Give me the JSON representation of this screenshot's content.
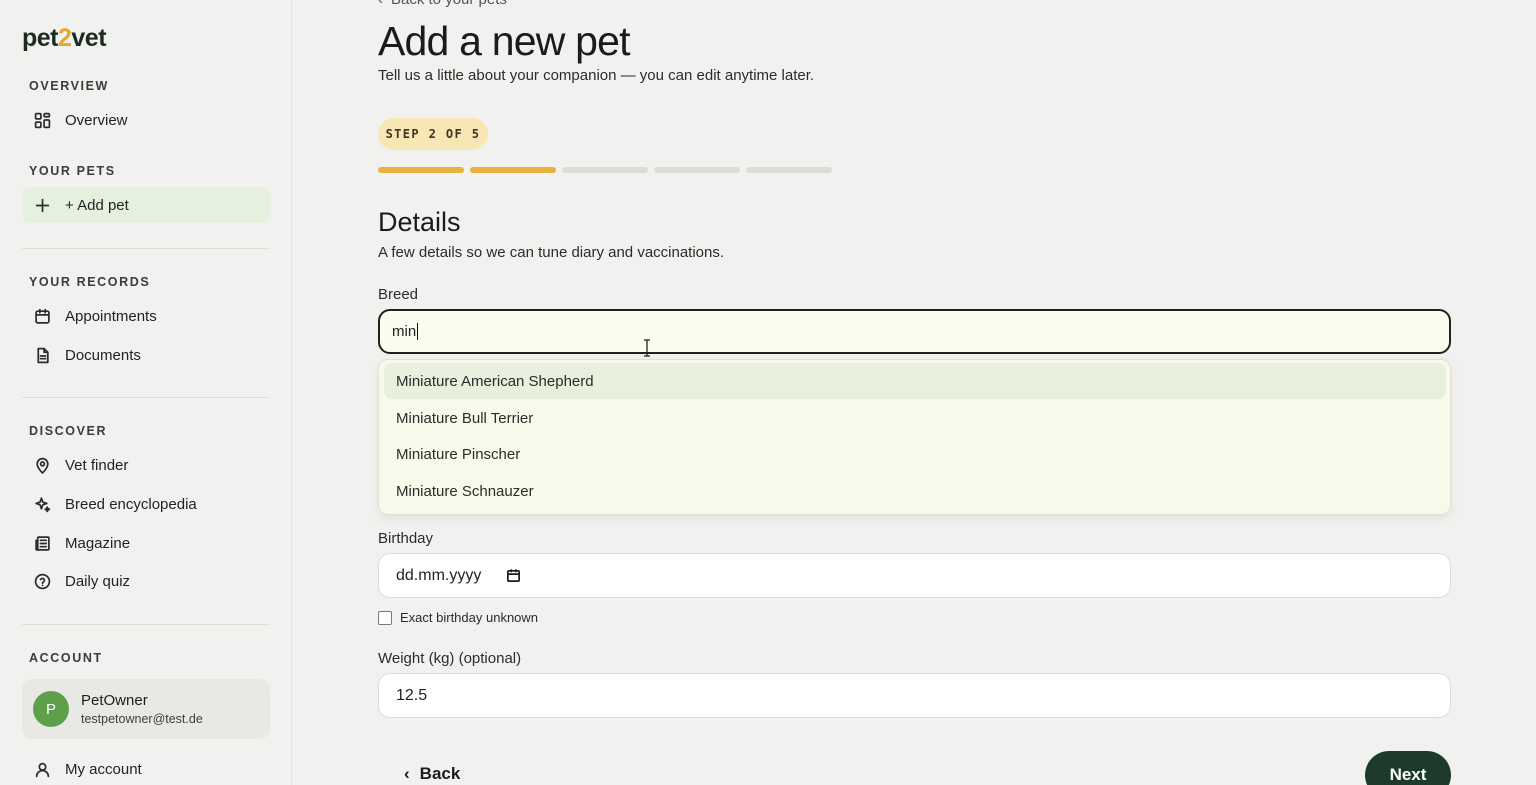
{
  "app": {
    "logo_left": "pet",
    "logo_mid": "2",
    "logo_right": "vet"
  },
  "sidebar": {
    "overview_label": "OVERVIEW",
    "overview_item": "Overview",
    "pets_label": "YOUR PETS",
    "add_pet": "+ Add pet",
    "records_label": "YOUR RECORDS",
    "appointments": "Appointments",
    "documents": "Documents",
    "discover_label": "DISCOVER",
    "vet_finder": "Vet finder",
    "breed_encyclopedia": "Breed encyclopedia",
    "magazine": "Magazine",
    "daily_quiz": "Daily quiz",
    "account_label": "ACCOUNT",
    "user": {
      "initial": "P",
      "name": "PetOwner",
      "email": "testpetowner@test.de"
    },
    "my_account": "My account"
  },
  "main": {
    "back_link": "Back to your pets",
    "title": "Add a new pet",
    "subtitle": "Tell us a little about your companion — you can edit anytime later.",
    "step_label": "STEP 2 OF 5",
    "progress": {
      "current": 2,
      "total": 5
    },
    "section_title": "Details",
    "section_subtitle": "A few details so we can tune diary and vaccinations.",
    "breed": {
      "label": "Breed",
      "value": "min",
      "suggestions": [
        "Miniature American Shepherd",
        "Miniature Bull Terrier",
        "Miniature Pinscher",
        "Miniature Schnauzer"
      ]
    },
    "birthday": {
      "label": "Birthday",
      "placeholder": "dd.mm.yyyy",
      "unknown_label": "Exact birthday unknown"
    },
    "weight": {
      "label": "Weight (kg) (optional)",
      "value": "12.5"
    },
    "back_button": "Back",
    "next_button": "Next"
  },
  "colors": {
    "accent": "#e9b23c",
    "primary": "#1e3a2d",
    "active_bg": "#e6f0df"
  }
}
